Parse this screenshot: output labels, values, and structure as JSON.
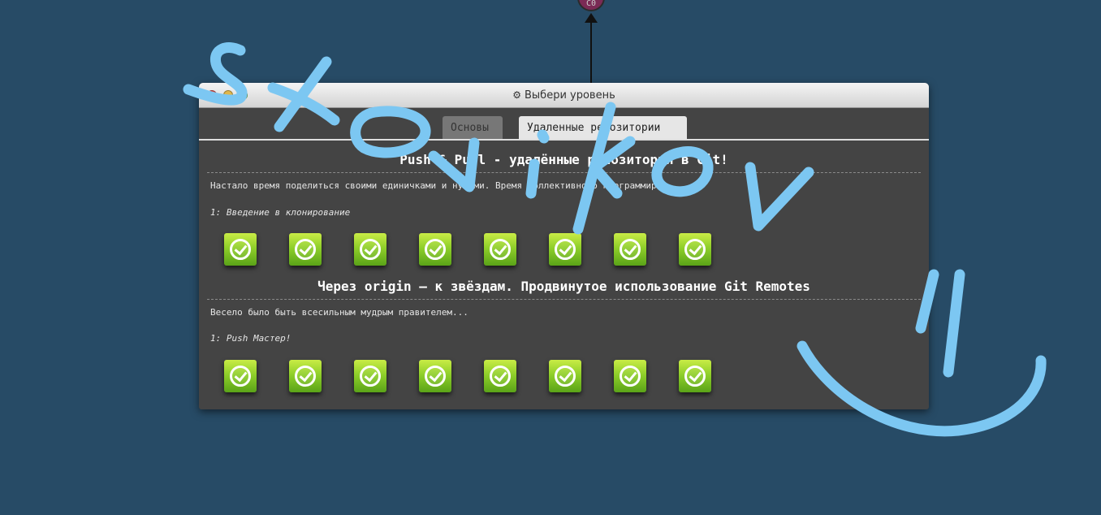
{
  "graph": {
    "node_label": "C0"
  },
  "window": {
    "title": "Выбери уровень",
    "tabs": [
      {
        "label": "Основы",
        "selected": false
      },
      {
        "label": "Удаленные репозитории",
        "selected": true
      }
    ]
  },
  "sections": [
    {
      "title": "Push & Pull - удалённые репозитории в Git!",
      "about": "Настало время поделиться своими единичками и нулями. Время коллективного программир",
      "level_heading": "1: Введение в клонирование",
      "levels_completed": [
        true,
        true,
        true,
        true,
        true,
        true,
        true,
        true
      ]
    },
    {
      "title": "Через origin – к звёздам. Продвинутое использование Git Remotes",
      "about": "Весело было быть всесильным мудрым правителем...",
      "level_heading": "1: Push Мастер!",
      "levels_completed": [
        true,
        true,
        true,
        true,
        true,
        true,
        true,
        true
      ]
    }
  ],
  "colors": {
    "background": "#274b66",
    "panel": "#444444",
    "level_done": "#8fcf2a",
    "scribble": "#7cc7f2"
  }
}
